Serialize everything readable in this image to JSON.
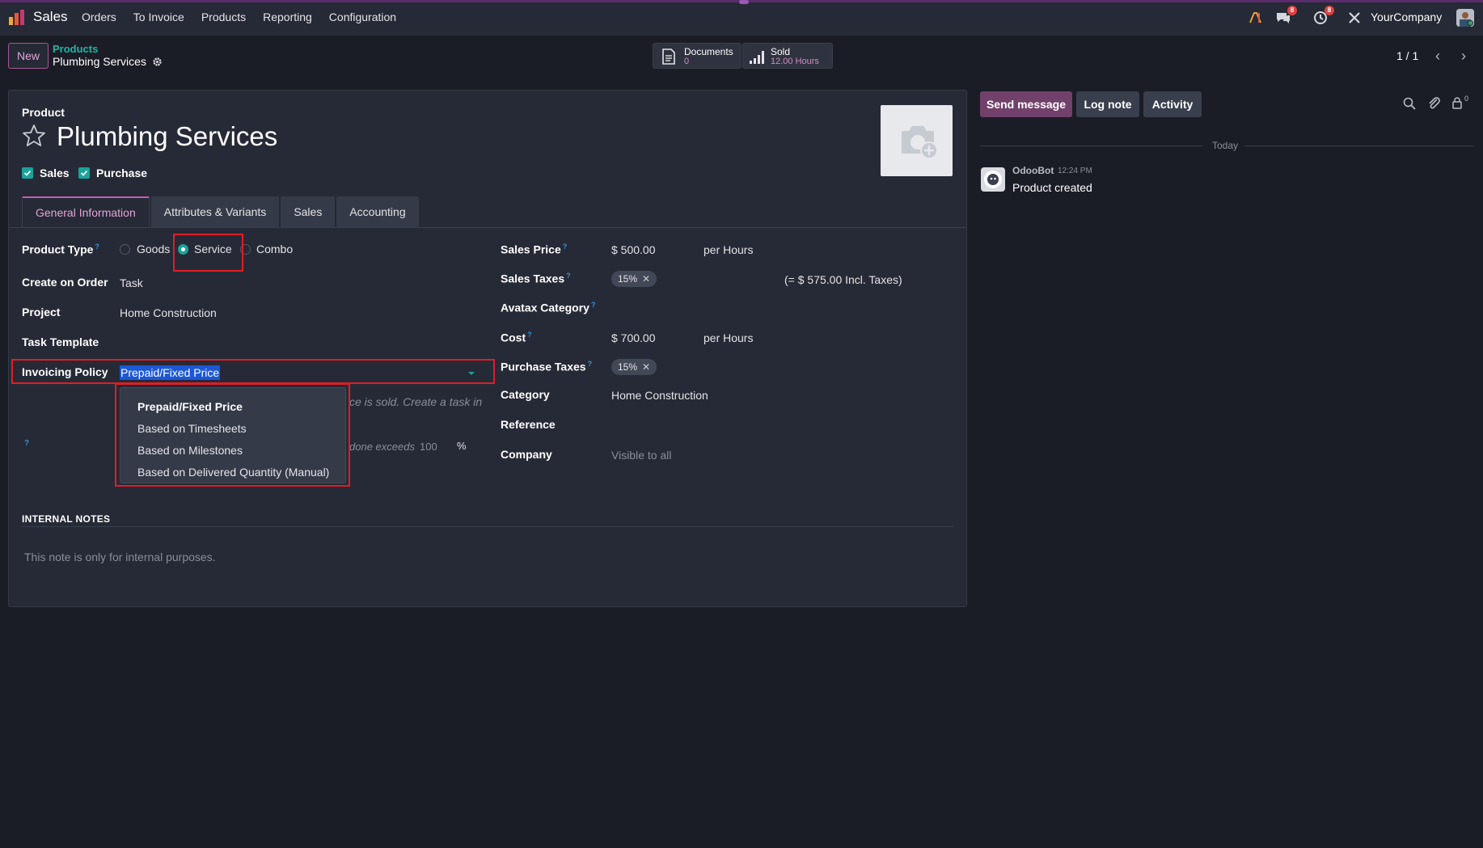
{
  "app": {
    "name": "Sales"
  },
  "menu": [
    "Orders",
    "To Invoice",
    "Products",
    "Reporting",
    "Configuration"
  ],
  "systray": {
    "company": "YourCompany",
    "messages_count": "8",
    "activities_count": "8"
  },
  "control": {
    "new_label": "New",
    "breadcrumb_parent": "Products",
    "breadcrumb_current": "Plumbing Services",
    "pager": "1 / 1"
  },
  "smart_buttons": {
    "documents": {
      "label": "Documents",
      "value": "0"
    },
    "sold": {
      "label": "Sold",
      "value": "12.00 Hours"
    }
  },
  "product": {
    "label": "Product",
    "name": "Plumbing Services",
    "sales_label": "Sales",
    "purchase_label": "Purchase"
  },
  "tabs": [
    "General Information",
    "Attributes & Variants",
    "Sales",
    "Accounting"
  ],
  "left_fields": {
    "product_type_label": "Product Type",
    "product_type_options": [
      "Goods",
      "Service",
      "Combo"
    ],
    "create_on_order_label": "Create on Order",
    "create_on_order_value": "Task",
    "project_label": "Project",
    "project_value": "Home Construction",
    "task_template_label": "Task Template",
    "invoicing_policy_label": "Invoicing Policy",
    "invoicing_policy_value": "Prepaid/Fixed Price",
    "hint_text_1": "ce is sold. Create a task in",
    "hint_text_2": "done exceeds",
    "hint_value": "100",
    "hint_unit": "%"
  },
  "policy_dropdown": {
    "options": [
      "Prepaid/Fixed Price",
      "Based on Timesheets",
      "Based on Milestones",
      "Based on Delivered Quantity (Manual)"
    ]
  },
  "right_fields": {
    "sales_price_label": "Sales Price",
    "sales_price_value": "$ 500.00",
    "sales_price_unit": "per Hours",
    "sales_taxes_label": "Sales Taxes",
    "sales_taxes_tag": "15%",
    "incl_taxes": "(= $ 575.00 Incl. Taxes)",
    "avatax_label": "Avatax Category",
    "cost_label": "Cost",
    "cost_value": "$ 700.00",
    "cost_unit": "per Hours",
    "purchase_taxes_label": "Purchase Taxes",
    "purchase_taxes_tag": "15%",
    "category_label": "Category",
    "category_value": "Home Construction",
    "reference_label": "Reference",
    "company_label": "Company",
    "company_value": "Visible to all"
  },
  "notes": {
    "title": "INTERNAL NOTES",
    "placeholder": "This note is only for internal purposes."
  },
  "chatter": {
    "send_message": "Send message",
    "log_note": "Log note",
    "activity": "Activity",
    "followers_count": "0",
    "date_separator": "Today",
    "message": {
      "author": "OdooBot",
      "time": "12:24 PM",
      "body": "Product created"
    }
  },
  "colors": {
    "accent": "#c55fb2",
    "teal": "#1aa39a",
    "highlight_box": "#e11d25",
    "primary_button": "#71416b"
  }
}
